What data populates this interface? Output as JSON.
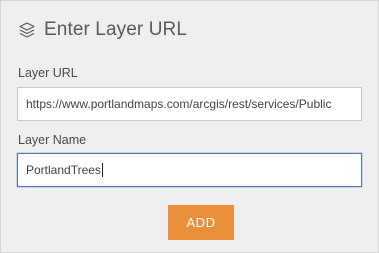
{
  "header": {
    "icon": "layers-icon",
    "title": "Enter Layer URL"
  },
  "form": {
    "url_label": "Layer URL",
    "url_value": "https://www.portlandmaps.com/arcgis/rest/services/Public",
    "name_label": "Layer Name",
    "name_value": "PortlandTrees"
  },
  "actions": {
    "add_label": "ADD"
  },
  "colors": {
    "panel_bg": "#efefef",
    "accent_button": "#e8913a",
    "focus_border": "#4a78b8"
  }
}
